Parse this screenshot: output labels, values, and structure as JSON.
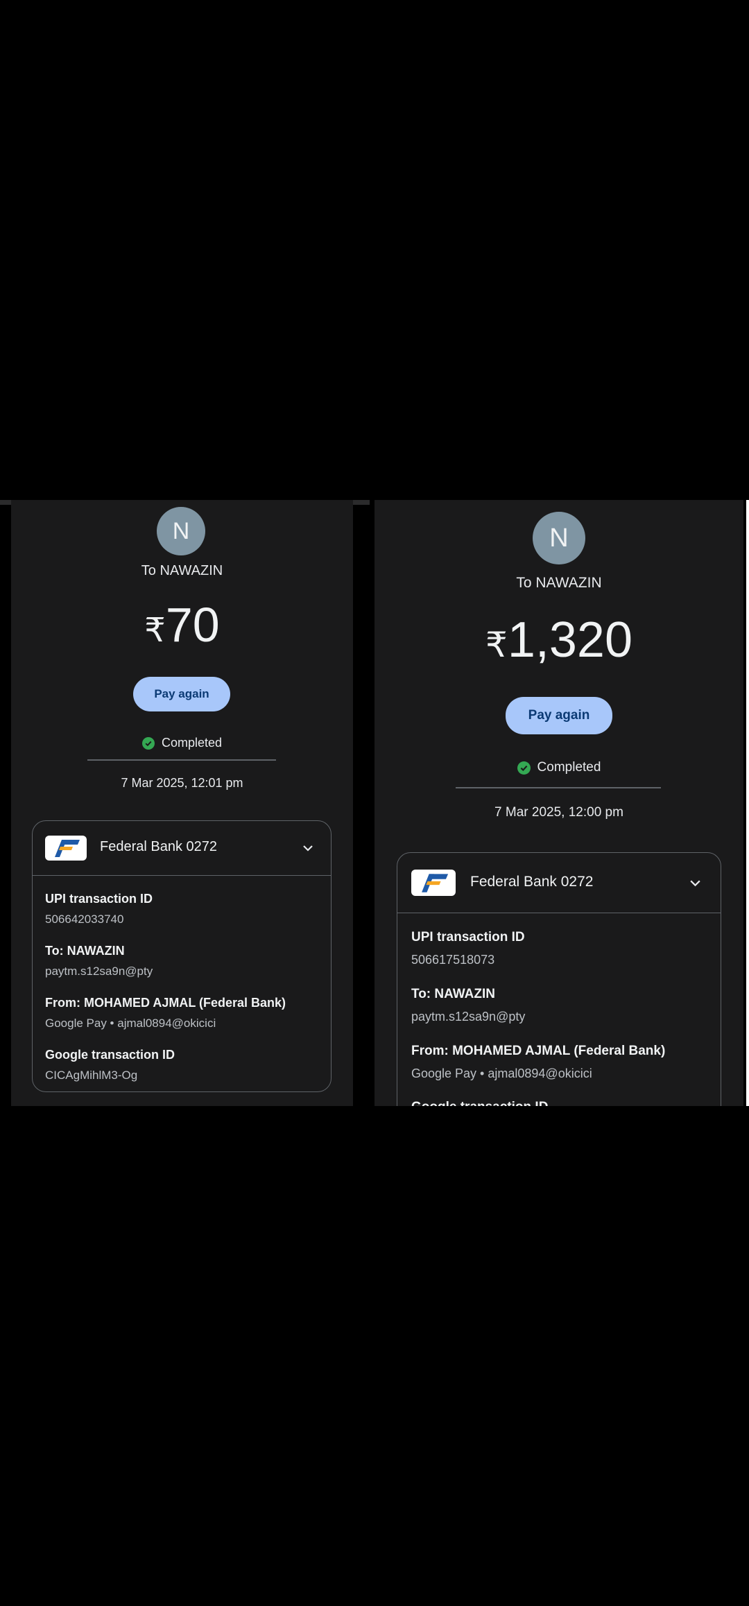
{
  "left": {
    "avatar_letter": "N",
    "to_label": "To NAWAZIN",
    "currency": "₹",
    "amount": "70",
    "pay_again": "Pay again",
    "status": "Completed",
    "datetime": "7 Mar 2025, 12:01 pm",
    "bank_name": "Federal Bank 0272",
    "upi_label": "UPI transaction ID",
    "upi_value": "506642033740",
    "to_field_label": "To: NAWAZIN",
    "to_field_value": "paytm.s12sa9n@pty",
    "from_label": "From: MOHAMED AJMAL (Federal Bank)",
    "from_value": "Google Pay • ajmal0894@okicici",
    "google_label": "Google transaction ID",
    "google_value": "CICAgMihlM3-Og"
  },
  "right": {
    "avatar_letter": "N",
    "to_label": "To NAWAZIN",
    "currency": "₹",
    "amount": "1,320",
    "pay_again": "Pay again",
    "status": "Completed",
    "datetime": "7 Mar 2025, 12:00 pm",
    "bank_name": "Federal Bank 0272",
    "upi_label": "UPI transaction ID",
    "upi_value": "506617518073",
    "to_field_label": "To: NAWAZIN",
    "to_field_value": "paytm.s12sa9n@pty",
    "from_label": "From: MOHAMED AJMAL (Federal Bank)",
    "from_value": "Google Pay • ajmal0894@okicici",
    "google_label": "Google transaction ID"
  },
  "colors": {
    "background": "#000000",
    "panel": "#1a1a1b",
    "button": "#a8c7fa",
    "success": "#34a853",
    "bank_blue": "#1f5aa8",
    "bank_orange": "#f5a623"
  },
  "icons": [
    "check-circle-icon",
    "chevron-down-icon",
    "federal-bank-logo"
  ]
}
